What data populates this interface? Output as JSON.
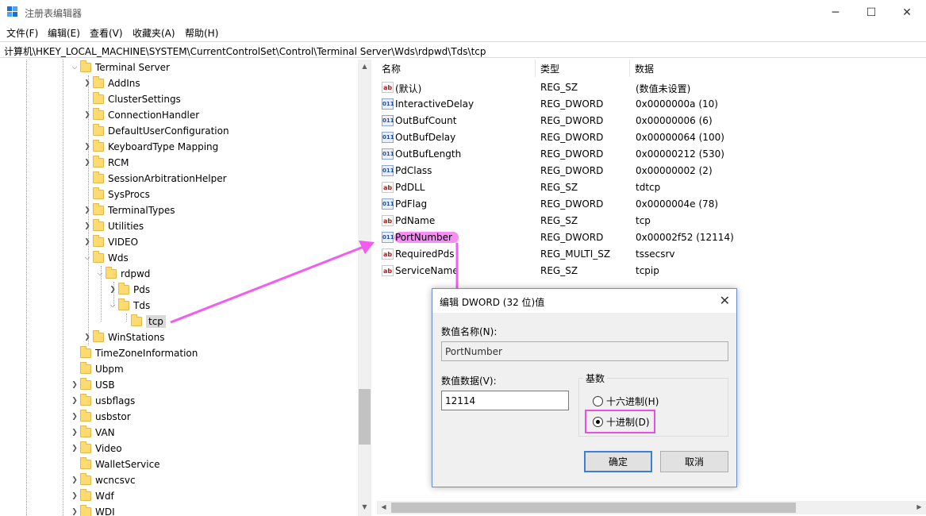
{
  "window": {
    "title": "注册表编辑器",
    "controls": {
      "minimize": "─",
      "maximize": "☐",
      "close": "✕"
    }
  },
  "menu": [
    "文件(F)",
    "编辑(E)",
    "查看(V)",
    "收藏夹(A)",
    "帮助(H)"
  ],
  "address": "计算机\\HKEY_LOCAL_MACHINE\\SYSTEM\\CurrentControlSet\\Control\\Terminal Server\\Wds\\rdpwd\\Tds\\tcp",
  "tree": [
    {
      "label": "Terminal Server",
      "chevron": "expanded"
    },
    {
      "label": "AddIns",
      "chevron": "collapsed"
    },
    {
      "label": "ClusterSettings",
      "chevron": ""
    },
    {
      "label": "ConnectionHandler",
      "chevron": "collapsed"
    },
    {
      "label": "DefaultUserConfiguration",
      "chevron": ""
    },
    {
      "label": "KeyboardType Mapping",
      "chevron": "collapsed"
    },
    {
      "label": "RCM",
      "chevron": "collapsed"
    },
    {
      "label": "SessionArbitrationHelper",
      "chevron": ""
    },
    {
      "label": "SysProcs",
      "chevron": ""
    },
    {
      "label": "TerminalTypes",
      "chevron": "collapsed"
    },
    {
      "label": "Utilities",
      "chevron": "collapsed"
    },
    {
      "label": "VIDEO",
      "chevron": "collapsed"
    },
    {
      "label": "Wds",
      "chevron": "expanded"
    },
    {
      "label": "rdpwd",
      "chevron": "expanded"
    },
    {
      "label": "Pds",
      "chevron": "collapsed"
    },
    {
      "label": "Tds",
      "chevron": "expanded"
    },
    {
      "label": "tcp",
      "chevron": "",
      "selected": true
    },
    {
      "label": "WinStations",
      "chevron": "collapsed"
    },
    {
      "label": "TimeZoneInformation",
      "chevron": ""
    },
    {
      "label": "Ubpm",
      "chevron": ""
    },
    {
      "label": "USB",
      "chevron": "collapsed"
    },
    {
      "label": "usbflags",
      "chevron": "collapsed"
    },
    {
      "label": "usbstor",
      "chevron": "collapsed"
    },
    {
      "label": "VAN",
      "chevron": "collapsed"
    },
    {
      "label": "Video",
      "chevron": "collapsed"
    },
    {
      "label": "WalletService",
      "chevron": ""
    },
    {
      "label": "wcncsvc",
      "chevron": "collapsed"
    },
    {
      "label": "Wdf",
      "chevron": "collapsed"
    },
    {
      "label": "WDI",
      "chevron": "collapsed"
    }
  ],
  "list": {
    "headers": {
      "name": "名称",
      "type": "类型",
      "data": "数据"
    },
    "rows": [
      {
        "icon": "string-value-icon",
        "name": "(默认)",
        "type": "REG_SZ",
        "data": "(数值未设置)"
      },
      {
        "icon": "binary-value-icon",
        "name": "InteractiveDelay",
        "type": "REG_DWORD",
        "data": "0x0000000a (10)"
      },
      {
        "icon": "binary-value-icon",
        "name": "OutBufCount",
        "type": "REG_DWORD",
        "data": "0x00000006 (6)"
      },
      {
        "icon": "binary-value-icon",
        "name": "OutBufDelay",
        "type": "REG_DWORD",
        "data": "0x00000064 (100)"
      },
      {
        "icon": "binary-value-icon",
        "name": "OutBufLength",
        "type": "REG_DWORD",
        "data": "0x00000212 (530)"
      },
      {
        "icon": "binary-value-icon",
        "name": "PdClass",
        "type": "REG_DWORD",
        "data": "0x00000002 (2)"
      },
      {
        "icon": "string-value-icon",
        "name": "PdDLL",
        "type": "REG_SZ",
        "data": "tdtcp"
      },
      {
        "icon": "binary-value-icon",
        "name": "PdFlag",
        "type": "REG_DWORD",
        "data": "0x0000004e (78)"
      },
      {
        "icon": "string-value-icon",
        "name": "PdName",
        "type": "REG_SZ",
        "data": "tcp"
      },
      {
        "icon": "binary-value-icon",
        "name": "PortNumber",
        "type": "REG_DWORD",
        "data": "0x00002f52 (12114)",
        "highlighted": true
      },
      {
        "icon": "string-value-icon",
        "name": "RequiredPds",
        "type": "REG_MULTI_SZ",
        "data": "tssecsrv"
      },
      {
        "icon": "string-value-icon",
        "name": "ServiceName",
        "type": "REG_SZ",
        "data": "tcpip"
      }
    ]
  },
  "icons": {
    "string": "ab",
    "binary": "011"
  },
  "dialog": {
    "title": "编辑 DWORD (32 位)值",
    "close": "✕",
    "name_label": "数值名称(N):",
    "name_value": "PortNumber",
    "data_label": "数值数据(V):",
    "data_value": "12114",
    "base_label": "基数",
    "radio_hex": "十六进制(H)",
    "radio_dec": "十进制(D)",
    "selected_base": "decimal",
    "ok": "确定",
    "cancel": "取消"
  },
  "colors": {
    "annotation": "#f25cf0",
    "accent": "#3c7fd6",
    "selection": "#d9d9d9"
  }
}
